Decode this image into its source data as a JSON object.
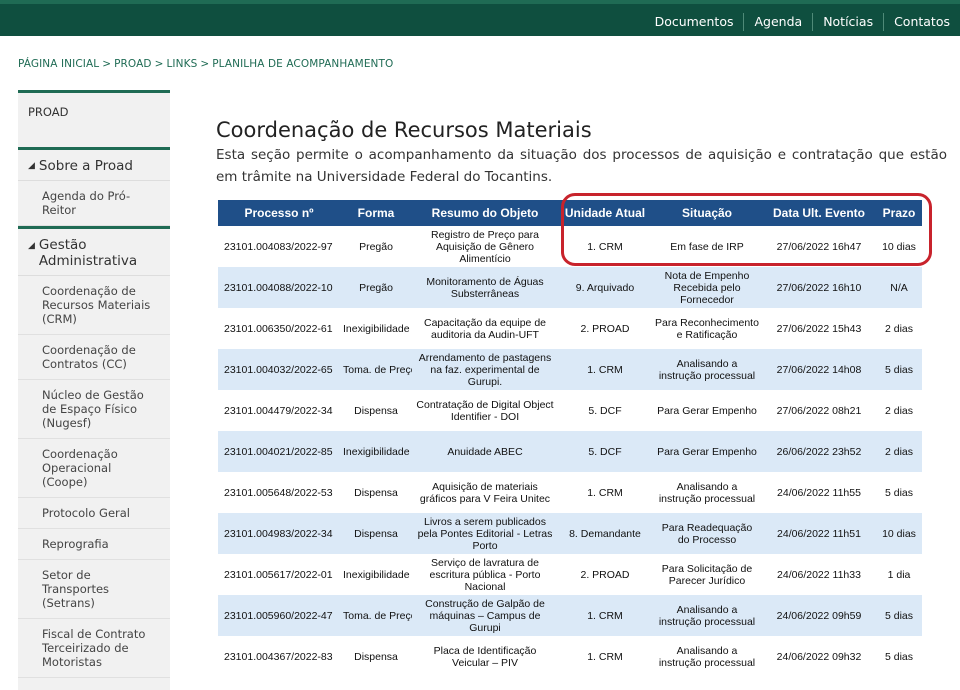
{
  "topnav": [
    "Documentos",
    "Agenda",
    "Notícias",
    "Contatos"
  ],
  "breadcrumb": [
    "PÁGINA INICIAL",
    "PROAD",
    "LINKS",
    "PLANILHA DE ACOMPANHAMENTO"
  ],
  "sidebar": {
    "head": "PROAD",
    "section1": "Sobre a Proad",
    "section1_items": [
      "Agenda do Pró-Reitor"
    ],
    "section2": "Gestão Administrativa",
    "section2_items": [
      "Coordenação de Recursos Materiais (CRM)",
      "Coordenação de Contratos (CC)",
      "Núcleo de Gestão de Espaço Físico (Nugesf)",
      "Coordenação Operacional (Coope)",
      "Protocolo Geral",
      "Reprografia",
      "Setor de Transportes (Setrans)",
      "Fiscal de Contrato Terceirizado de Motoristas"
    ]
  },
  "main": {
    "title": "Coordenação de Recursos Materiais",
    "intro": "Esta seção permite o acompanhamento da situação dos processos de aquisição e contratação que estão em trâmite na Universidade Federal do Tocantins."
  },
  "table": {
    "headers": [
      "Processo nº",
      "Forma",
      "Resumo do Objeto",
      "Unidade Atual",
      "Situação",
      "Data Ult. Evento",
      "Prazo"
    ],
    "rows": [
      [
        "23101.004083/2022-97",
        "Pregão",
        "Registro de Preço para Aquisição de Gênero Alimentício",
        "1. CRM",
        "Em fase de IRP",
        "27/06/2022 16h47",
        "10 dias"
      ],
      [
        "23101.004088/2022-10",
        "Pregão",
        "Monitoramento de Águas Substerrâneas",
        "9. Arquivado",
        "Nota de Empenho Recebida pelo Fornecedor",
        "27/06/2022 16h10",
        "N/A"
      ],
      [
        "23101.006350/2022-61",
        "Inexigibilidade",
        "Capacitação da equipe de auditoria da Audin-UFT",
        "2. PROAD",
        "Para Reconhecimento e Ratificação",
        "27/06/2022 15h43",
        "2 dias"
      ],
      [
        "23101.004032/2022-65",
        "Toma. de Preços",
        "Arrendamento de pastagens na faz. experimental de Gurupi.",
        "1. CRM",
        "Analisando a instrução processual",
        "27/06/2022 14h08",
        "5 dias"
      ],
      [
        "23101.004479/2022-34",
        "Dispensa",
        "Contratação de Digital Object Identifier - DOI",
        "5. DCF",
        "Para Gerar Empenho",
        "27/06/2022 08h21",
        "2 dias"
      ],
      [
        "23101.004021/2022-85",
        "Inexigibilidade",
        "Anuidade ABEC",
        "5. DCF",
        "Para Gerar Empenho",
        "26/06/2022 23h52",
        "2 dias"
      ],
      [
        "23101.005648/2022-53",
        "Dispensa",
        "Aquisição de materiais gráficos para V Feira Unitec",
        "1. CRM",
        "Analisando a instrução processual",
        "24/06/2022 11h55",
        "5 dias"
      ],
      [
        "23101.004983/2022-34",
        "Dispensa",
        "Livros a serem publicados pela Pontes Editorial - Letras Porto",
        "8. Demandante",
        "Para Readequação do Processo",
        "24/06/2022 11h51",
        "10 dias"
      ],
      [
        "23101.005617/2022-01",
        "Inexigibilidade",
        "Serviço de lavratura de escritura pública - Porto Nacional",
        "2. PROAD",
        "Para Solicitação de Parecer Jurídico",
        "24/06/2022 11h33",
        "1 dia"
      ],
      [
        "23101.005960/2022-47",
        "Toma. de Preços",
        "Construção de Galpão de máquinas – Campus de Gurupi",
        "1. CRM",
        "Analisando a instrução processual",
        "24/06/2022 09h59",
        "5 dias"
      ],
      [
        "23101.004367/2022-83",
        "Dispensa",
        "Placa de Identificação Veicular – PIV",
        "1. CRM",
        "Analisando a instrução processual",
        "24/06/2022 09h32",
        "5 dias"
      ]
    ]
  }
}
